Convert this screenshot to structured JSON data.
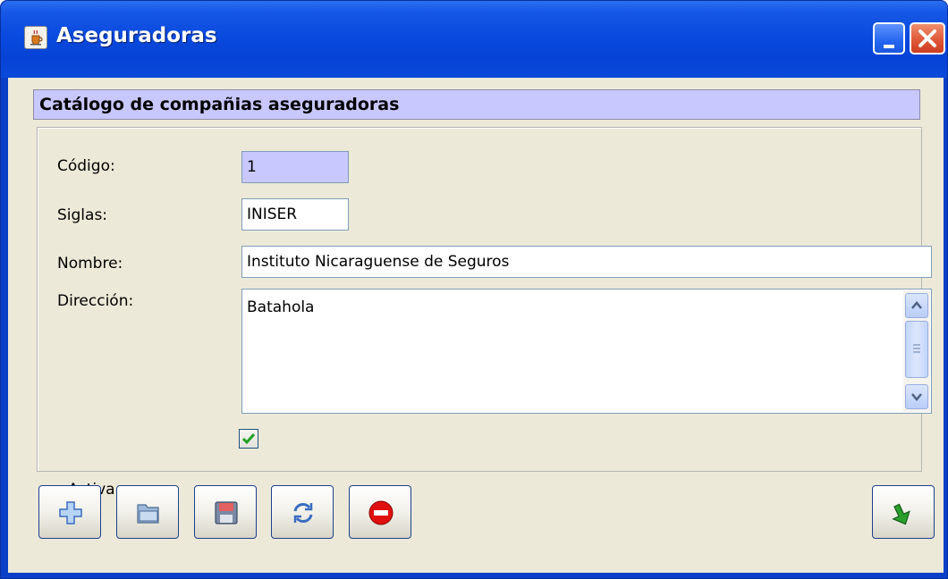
{
  "window": {
    "title": "Aseguradoras",
    "title_icon": "java-cup-icon"
  },
  "header": {
    "title": "Catálogo de compañias aseguradoras"
  },
  "form": {
    "codigo": {
      "label": "Código:",
      "value": "1"
    },
    "siglas": {
      "label": "Siglas:",
      "value": "INISER"
    },
    "nombre": {
      "label": "Nombre:",
      "value": "Instituto Nicaraguense de Seguros"
    },
    "direccion": {
      "label": "Dirección:",
      "value": "Batahola"
    },
    "activa": {
      "label": "Activa",
      "checked": true
    }
  },
  "toolbar": {
    "buttons": [
      "add-icon",
      "open-folder-icon",
      "save-disk-icon",
      "refresh-icon",
      "stop-icon"
    ],
    "exit_button": "exit-arrow-icon"
  },
  "colors": {
    "titlebar": "#0a4adf",
    "header_band": "#c8c8ff",
    "window_bg": "#ece9d8",
    "check": "#21a121",
    "stop": "#e01010"
  }
}
